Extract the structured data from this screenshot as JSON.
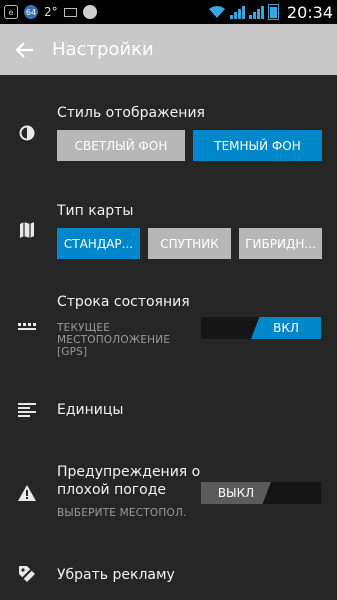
{
  "status_bar": {
    "icon_1": "e",
    "icon_2": "64",
    "temperature": "2°",
    "time": "20:34"
  },
  "toolbar": {
    "title": "Настройки"
  },
  "display_style": {
    "label": "Стиль отображения",
    "options": [
      "СВЕТЛЫЙ ФОН",
      "ТЕМНЫЙ ФОН"
    ],
    "selected": "ТЕМНЫЙ ФОН"
  },
  "map_type": {
    "label": "Тип карты",
    "options": [
      "СТАНДАР...",
      "СПУТНИК",
      "ГИБРИДН..."
    ],
    "selected": "СТАНДАР..."
  },
  "status_line": {
    "label": "Строка состояния",
    "sub_label": "ТЕКУЩЕЕ МЕСТОПОЛОЖЕНИЕ [GPS]",
    "toggle_label": "ВКЛ"
  },
  "units": {
    "label": "Единицы"
  },
  "weather_warnings": {
    "label": "Предупреждения о плохой погоде",
    "sub_label": "ВЫБЕРИТЕ МЕСТОПОЛ.",
    "toggle_label": "ВЫКЛ"
  },
  "remove_ads": {
    "label": "Убрать рекламу"
  },
  "colors": {
    "accent": "#0087c9",
    "background": "#262626",
    "toolbar": "#c8c8c8"
  }
}
